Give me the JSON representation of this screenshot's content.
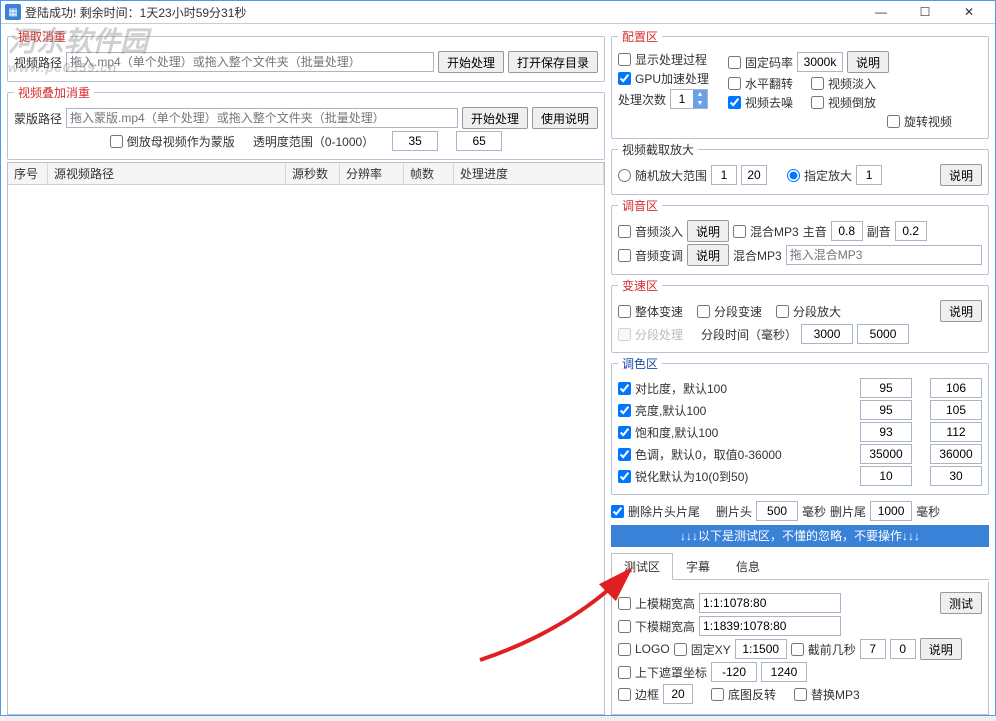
{
  "window": {
    "title": "登陆成功! 剩余时间：1天23小时59分31秒"
  },
  "watermark": {
    "text": "河东软件园",
    "url": "www.pc0359.cn"
  },
  "left": {
    "fieldset1": {
      "legend": "提取消重",
      "path_label": "视频路径",
      "path_placeholder": "拖入.mp4（单个处理）或拖入整个文件夹（批量处理）",
      "btn_start": "开始处理",
      "btn_open": "打开保存目录"
    },
    "fieldset2": {
      "legend": "视频叠加消重",
      "path_label": "蒙版路径",
      "path_placeholder": "拖入蒙版.mp4（单个处理）或拖入整个文件夹（批量处理）",
      "btn_start": "开始处理",
      "btn_help": "使用说明",
      "cb_reverse": "倒放母视频作为蒙版",
      "opacity_label": "透明度范围（0-1000）",
      "opacity_from": "35",
      "opacity_to": "65"
    },
    "table": {
      "cols": [
        "序号",
        "源视频路径",
        "源秒数",
        "分辨率",
        "帧数",
        "处理进度"
      ]
    }
  },
  "right": {
    "config": {
      "legend": "配置区",
      "cb_showlog": "显示处理过程",
      "cb_gpu": "GPU加速处理",
      "times_label": "处理次数",
      "times_val": "1",
      "cb_fixed_rate": "固定码率",
      "rate_val": "3000k",
      "btn_help": "说明",
      "cb_hflip": "水平翻转",
      "cb_denoise": "视频去噪",
      "cb_fadein": "视频淡入",
      "cb_rev": "视频倒放",
      "cb_rotate": "旋转视频"
    },
    "crop": {
      "legend": "视频截取放大",
      "rb_random": "随机放大范围",
      "rand_from": "1",
      "rand_to": "20",
      "rb_fixed": "指定放大",
      "fixed_val": "1",
      "btn_help": "说明"
    },
    "audio": {
      "legend": "调音区",
      "cb_afadein": "音频淡入",
      "btn_help1": "说明",
      "cb_mixmp3": "混合MP3",
      "main_label": "主音",
      "main_val": "0.8",
      "sub_label": "副音",
      "sub_val": "0.2",
      "cb_pitch": "音频变调",
      "btn_help2": "说明",
      "mixmp3_label": "混合MP3",
      "mixmp3_placeholder": "拖入混合MP3"
    },
    "speed": {
      "legend": "变速区",
      "cb_whole": "整体变速",
      "cb_period": "分段变速",
      "cb_zoom": "分段放大",
      "btn_help": "说明",
      "cb_segproc": "分段处理",
      "seg_label": "分段时间（毫秒）",
      "seg_from": "3000",
      "seg_to": "5000"
    },
    "color": {
      "legend": "调色区",
      "rows": [
        {
          "label": "对比度，默认100",
          "a": "95",
          "b": "106"
        },
        {
          "label": "亮度,默认100",
          "a": "95",
          "b": "105"
        },
        {
          "label": "饱和度,默认100",
          "a": "93",
          "b": "112"
        },
        {
          "label": "色调，默认0，取值0-36000",
          "a": "35000",
          "b": "36000"
        },
        {
          "label": "锐化默认为10(0到50)",
          "a": "10",
          "b": "30"
        }
      ]
    },
    "trim": {
      "cb_trim": "删除片头片尾",
      "head_label": "删片头",
      "head_val": "500",
      "ms1": "毫秒",
      "tail_label": "删片尾",
      "tail_val": "1000",
      "ms2": "毫秒"
    },
    "warn": "↓↓↓以下是测试区，不懂的忽略，不要操作↓↓↓",
    "tabs": [
      "测试区",
      "字幕",
      "信息"
    ],
    "test": {
      "cb_top": "上模糊宽高",
      "top_val": "1:1:1078:80",
      "btn_test": "测试",
      "cb_bottom": "下模糊宽高",
      "bottom_val": "1:1839:1078:80",
      "cb_logo": "LOGO",
      "cb_fixxy": "固定XY",
      "fixxy_val": "1:1500",
      "cb_cutfront": "截前几秒",
      "cut_a": "7",
      "cut_b": "0",
      "btn_help": "说明",
      "cb_mask": "上下遮罩坐标",
      "mask_a": "-120",
      "mask_b": "1240",
      "cb_border": "边框",
      "border_val": "20",
      "cb_invert": "底图反转",
      "cb_replmp3": "替换MP3"
    }
  }
}
